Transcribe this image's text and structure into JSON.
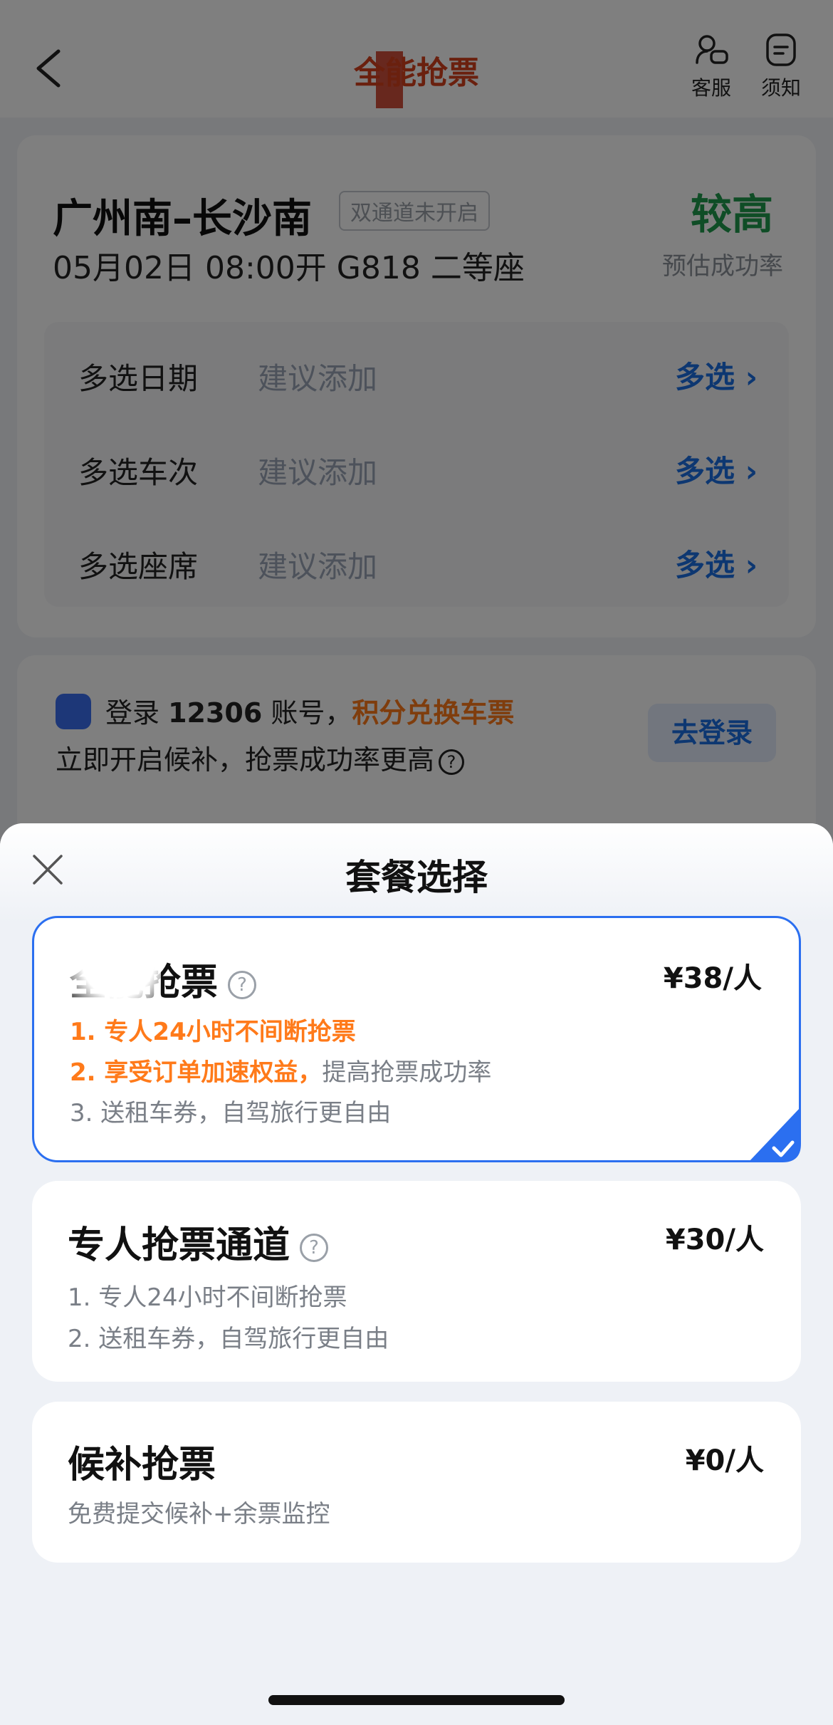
{
  "header": {
    "title": "全能抢票",
    "service_label": "客服",
    "notice_label": "须知",
    "service_icon": "customer-service-icon",
    "notice_icon": "notice-icon"
  },
  "trip": {
    "route": "广州南–长沙南",
    "channel_tag": "双通道未开启",
    "detail": "05月02日 08:00开 G818 二等座",
    "success_rate": "较高",
    "success_rate_label": "预估成功率",
    "multi_options": [
      {
        "label": "多选日期",
        "hint": "建议添加",
        "action": "多选"
      },
      {
        "label": "多选车次",
        "hint": "建议添加",
        "action": "多选"
      },
      {
        "label": "多选座席",
        "hint": "建议添加",
        "action": "多选"
      }
    ]
  },
  "login_card": {
    "line1_prefix": "登录",
    "line1_number": "12306",
    "line1_mid": "账号，",
    "line1_highlight": "积分兑换车票",
    "line2": "立即开启候补，抢票成功率更高",
    "button": "去登录"
  },
  "sheet": {
    "title": "套餐选择",
    "packages": [
      {
        "name": "全能抢票",
        "price": "¥38/人",
        "selected": true,
        "features": [
          {
            "highlight": "1. 专人24小时不间断抢票",
            "rest": ""
          },
          {
            "highlight": "2. 享受订单加速权益，",
            "rest": "提高抢票成功率"
          },
          {
            "highlight": "",
            "rest": "3. 送租车券，自驾旅行更自由"
          }
        ]
      },
      {
        "name": "专人抢票通道",
        "price": "¥30/人",
        "selected": false,
        "features": [
          {
            "highlight": "",
            "rest": "1. 专人24小时不间断抢票"
          },
          {
            "highlight": "",
            "rest": "2. 送租车券，自驾旅行更自由"
          }
        ]
      },
      {
        "name": "候补抢票",
        "price": "¥0/人",
        "selected": false,
        "features": [
          {
            "highlight": "",
            "rest": "免费提交候补+余票监控"
          }
        ]
      }
    ]
  },
  "colors": {
    "accent_blue": "#2b6ff0",
    "highlight_orange": "#ff7a1a",
    "rate_green": "#1e9a4c",
    "title_red": "#d5401d"
  }
}
